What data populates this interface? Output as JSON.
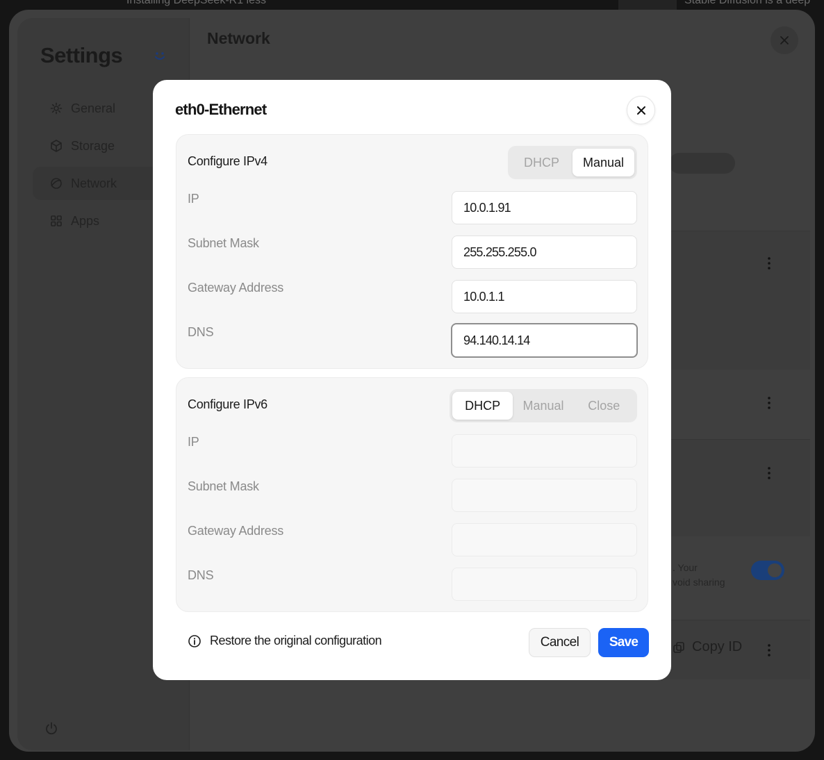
{
  "background": {
    "top_left_text": "Installing DeepSeek-R1 less",
    "top_right_text": "Stable Diffusion is a deep",
    "settings_title": "Settings",
    "nav": [
      {
        "label": "General",
        "icon": "gear-icon"
      },
      {
        "label": "Storage",
        "icon": "cube-icon"
      },
      {
        "label": "Network",
        "icon": "globe-icon",
        "active": true
      },
      {
        "label": "Apps",
        "icon": "grid-icon"
      }
    ],
    "main_title": "Network",
    "privacy_text_1": ". Your",
    "privacy_text_2": "void sharing",
    "copy_id_label": "Copy ID",
    "toggle_on": true
  },
  "modal": {
    "title": "eth0-Ethernet",
    "ipv4": {
      "title": "Configure IPv4",
      "modes": [
        "DHCP",
        "Manual"
      ],
      "selected_mode": "Manual",
      "fields": {
        "ip_label": "IP",
        "ip_value": "10.0.1.91",
        "subnet_label": "Subnet Mask",
        "subnet_value": "255.255.255.0",
        "gateway_label": "Gateway Address",
        "gateway_value": "10.0.1.1",
        "dns_label": "DNS",
        "dns_value": "94.140.14.14"
      }
    },
    "ipv6": {
      "title": "Configure IPv6",
      "modes": [
        "DHCP",
        "Manual",
        "Close"
      ],
      "selected_mode": "DHCP",
      "fields": {
        "ip_label": "IP",
        "ip_value": "",
        "subnet_label": "Subnet Mask",
        "subnet_value": "",
        "gateway_label": "Gateway Address",
        "gateway_value": "",
        "dns_label": "DNS",
        "dns_value": ""
      }
    },
    "restore_label": "Restore the original configuration",
    "cancel_label": "Cancel",
    "save_label": "Save"
  },
  "colors": {
    "accent": "#1b63f5",
    "toggle_on": "#1a3f7a"
  }
}
